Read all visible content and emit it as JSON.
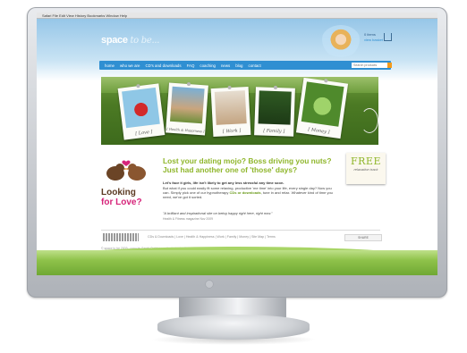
{
  "browser": {
    "menubar_text": "Safari  File  Edit  View  History  Bookmarks  Window  Help"
  },
  "site": {
    "logo_main": "space",
    "logo_accent": "to be...",
    "user": {
      "line1": "0 items",
      "line2": "view basket"
    }
  },
  "nav": {
    "items": [
      "home",
      "who we are",
      "CD's and downloads",
      "FAQ",
      "coaching",
      "news",
      "blog",
      "contact"
    ],
    "search_placeholder": "Search products"
  },
  "banner": {
    "captions": [
      "Love",
      "Health & Happiness",
      "Work",
      "Family",
      "Money"
    ],
    "colors": {
      "grass": "#4c7a24",
      "card": "#fbfbf7"
    }
  },
  "promo": {
    "title_line1": "Looking",
    "title_line2": "for Love?",
    "headline": "Lost your dating mojo? Boss driving you nuts? Just had another one of 'those' days?",
    "body_bold": "Let's face it girls, life isn't likely to get any less stressful any time soon.",
    "body_pre": "But what if you could easily fit some relaxing, productive 'me time' into your life, every single day? Now you can. Simply pick one of our hypnotherapy",
    "body_link": "CDs or downloads",
    "body_post": ", tune in and relax. Whatever kind of time you need, we've got it sorted.",
    "quote": "\"A brilliant and inspirational site on being happy right here, right now.\"",
    "quote_source": "Health & Fitness magazine Nov 2009"
  },
  "free_card": {
    "title": "FREE",
    "subtitle": "relaxation track"
  },
  "footer": {
    "links": "CDs & Downloads | Love | Health & Happiness | Work | Family | Money | Site Map | Terms",
    "share": "SHARE",
    "copyright": "© space to be 2009 - copy by Sarah Crabtree - site design by Pink sky"
  },
  "colors": {
    "nav": "#2f8fd2",
    "accent_green": "#8fb62b",
    "accent_pink": "#d6247a",
    "brown": "#5b3a22"
  }
}
